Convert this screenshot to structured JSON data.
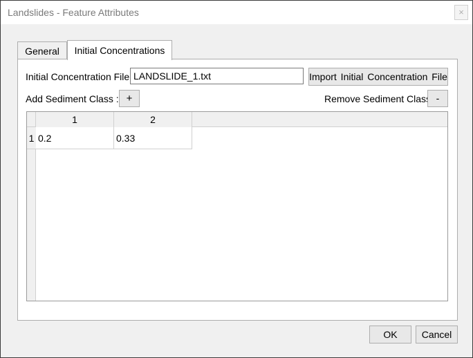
{
  "window": {
    "title": "Landslides - Feature Attributes",
    "close_label": "×"
  },
  "tabs": [
    {
      "label": "General",
      "active": false
    },
    {
      "label": "Initial Concentrations",
      "active": true
    }
  ],
  "form": {
    "file_label": "Initial Concentration File",
    "file_value": "LANDSLIDE_1.txt",
    "import_label": "Import Initial Concentration  File",
    "add_label": "Add Sediment Class :",
    "add_button": "+",
    "remove_label": "Remove Sediment Class",
    "remove_button": "-"
  },
  "table": {
    "columns": [
      "1",
      "2"
    ],
    "rows": [
      {
        "header": "1",
        "cells": [
          "0.2",
          "0.33"
        ]
      }
    ]
  },
  "footer": {
    "ok_label": "OK",
    "cancel_label": "Cancel"
  }
}
